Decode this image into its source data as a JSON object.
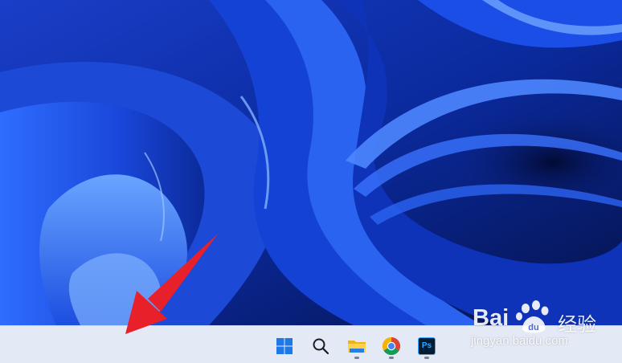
{
  "desktop": {
    "wallpaper": "Windows 11 blue bloom",
    "colors": {
      "deep": "#061e8c",
      "mid": "#1a4be0",
      "light": "#4f8cff",
      "highlight": "#9cc3ff",
      "taskbar": "#e4e9f6"
    }
  },
  "taskbar": {
    "items": [
      {
        "id": "start",
        "icon": "windows-logo-icon",
        "running": false
      },
      {
        "id": "search",
        "icon": "search-icon",
        "running": false
      },
      {
        "id": "explorer",
        "icon": "folder-icon",
        "running": true
      },
      {
        "id": "chrome",
        "icon": "chrome-icon",
        "running": true
      },
      {
        "id": "photoshop",
        "icon": "photoshop-icon",
        "label": "Ps",
        "running": true
      }
    ]
  },
  "annotation": {
    "arrow_color": "#e8202a"
  },
  "watermark": {
    "logo_part1": "Bai",
    "logo_part2": "经验",
    "url": "jingyan.baidu.com"
  }
}
